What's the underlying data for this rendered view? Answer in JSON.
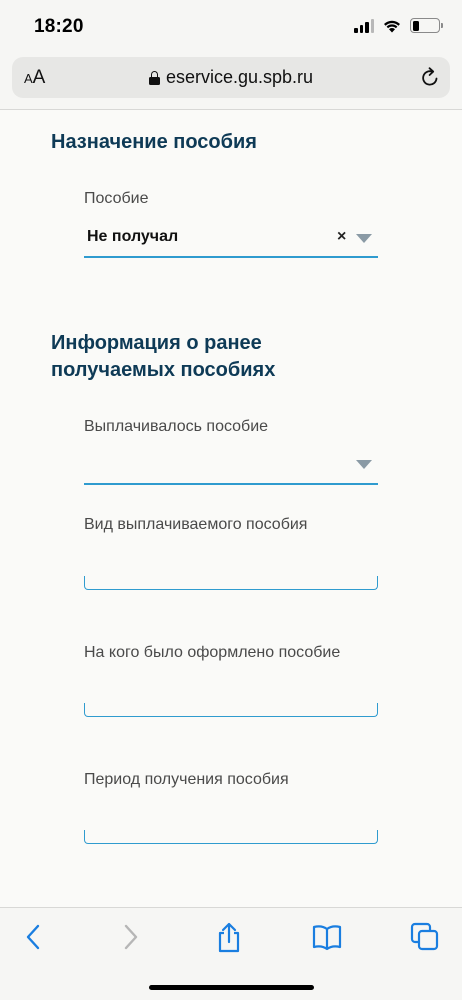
{
  "status": {
    "time": "18:20"
  },
  "browser": {
    "text_size_label": "AA",
    "url": "eservice.gu.spb.ru"
  },
  "section_benefit": {
    "title": "Назначение пособия",
    "field_label": "Пособие",
    "field_value": "Не получал",
    "clear_icon": "×"
  },
  "section_info": {
    "title_line1": "Информация о ранее",
    "title_line2": "получаемых пособиях",
    "fields": [
      {
        "label": "Выплачивалось пособие",
        "value": ""
      },
      {
        "label": "Вид выплачиваемого пособия",
        "value": ""
      },
      {
        "label": "На кого было оформлено пособие",
        "value": ""
      },
      {
        "label": "Период получения пособия",
        "value": ""
      }
    ]
  },
  "toolbar": {
    "icons": [
      "back-icon",
      "forward-icon",
      "share-icon",
      "bookmarks-icon",
      "tabs-icon"
    ]
  },
  "colors": {
    "accent": "#2f9bcf",
    "heading": "#0e3a56",
    "caret": "#8a9aa5"
  }
}
